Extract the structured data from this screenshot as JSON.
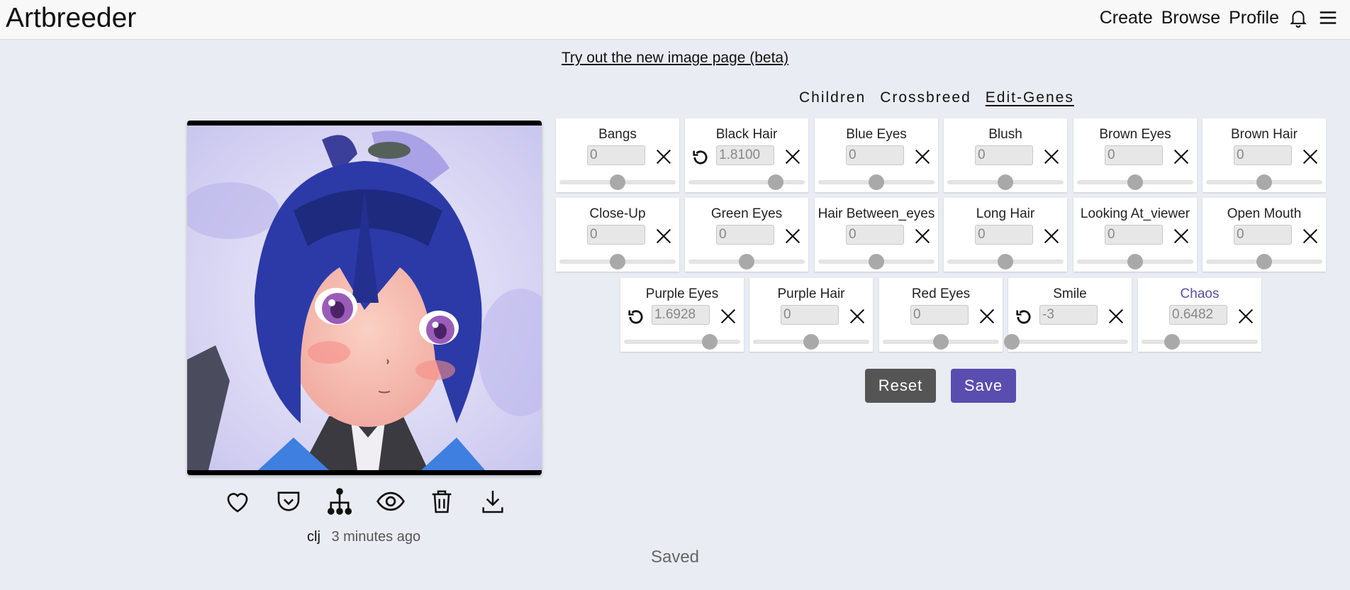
{
  "header": {
    "logo": "Artbreeder",
    "nav": [
      "Create",
      "Browse",
      "Profile"
    ],
    "icons": [
      "bell-icon",
      "menu-icon"
    ]
  },
  "beta_link": "Try out the new image page (beta)",
  "tabs": [
    "Children",
    "Crossbreed",
    "Edit-Genes"
  ],
  "active_tab": "Edit-Genes",
  "image": {
    "author": "clj",
    "time": "3 minutes ago",
    "actions": [
      "heart-icon",
      "save-pocket-icon",
      "lineage-tree-icon",
      "eye-icon",
      "trash-icon",
      "download-icon"
    ]
  },
  "genes": [
    {
      "name": "Bangs",
      "value": "0",
      "slider": 0.5,
      "reset": false
    },
    {
      "name": "Black Hair",
      "value": "1.8100",
      "slider": 0.75,
      "reset": true
    },
    {
      "name": "Blue Eyes",
      "value": "0",
      "slider": 0.5,
      "reset": false
    },
    {
      "name": "Blush",
      "value": "0",
      "slider": 0.5,
      "reset": false
    },
    {
      "name": "Brown Eyes",
      "value": "0",
      "slider": 0.5,
      "reset": false
    },
    {
      "name": "Brown Hair",
      "value": "0",
      "slider": 0.5,
      "reset": false
    },
    {
      "name": "Close-Up",
      "value": "0",
      "slider": 0.5,
      "reset": false
    },
    {
      "name": "Green Eyes",
      "value": "0",
      "slider": 0.5,
      "reset": false
    },
    {
      "name": "Hair Between_eyes",
      "value": "0",
      "slider": 0.5,
      "reset": false
    },
    {
      "name": "Long Hair",
      "value": "0",
      "slider": 0.5,
      "reset": false
    },
    {
      "name": "Looking At_viewer",
      "value": "0",
      "slider": 0.5,
      "reset": false
    },
    {
      "name": "Open Mouth",
      "value": "0",
      "slider": 0.5,
      "reset": false
    },
    {
      "name": "Purple Eyes",
      "value": "1.6928",
      "slider": 0.74,
      "reset": true
    },
    {
      "name": "Purple Hair",
      "value": "0",
      "slider": 0.5,
      "reset": false
    },
    {
      "name": "Red Eyes",
      "value": "0",
      "slider": 0.5,
      "reset": false
    },
    {
      "name": "Smile",
      "value": "-3",
      "slider": 0.0,
      "reset": true
    },
    {
      "name": "Chaos",
      "value": "0.6482",
      "slider": 0.26,
      "reset": false,
      "accent": true
    }
  ],
  "buttons": {
    "reset": "Reset",
    "save": "Save"
  },
  "status": "Saved",
  "colors": {
    "save_button": "#5a4db0",
    "reset_button": "#555555",
    "chaos_label": "#5a4fa0"
  }
}
